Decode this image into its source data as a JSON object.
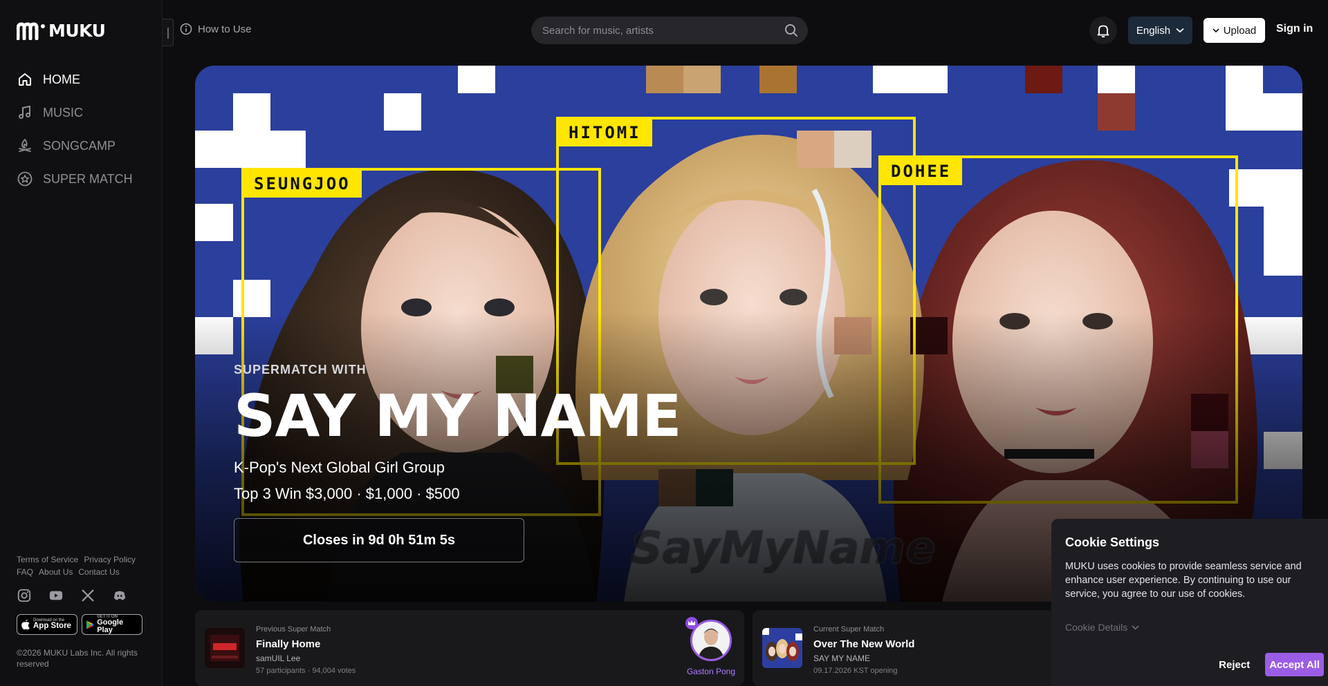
{
  "app": {
    "name": "MUKU"
  },
  "sidebar": {
    "items": [
      {
        "label": "HOME",
        "icon": "home-icon",
        "active": true
      },
      {
        "label": "MUSIC",
        "icon": "music-note-icon",
        "active": false
      },
      {
        "label": "SONGCAMP",
        "icon": "campfire-icon",
        "active": false
      },
      {
        "label": "SUPER MATCH",
        "icon": "star-badge-icon",
        "active": false
      }
    ],
    "footer_links": [
      "Terms of Service",
      "Privacy Policy",
      "FAQ",
      "About Us",
      "Contact Us"
    ],
    "socials": [
      "instagram-icon",
      "youtube-icon",
      "x-icon",
      "discord-icon"
    ],
    "stores": {
      "app_store": {
        "small": "Download on the",
        "big": "App Store"
      },
      "google_play": {
        "small": "GET IT ON",
        "big": "Google Play"
      }
    },
    "copyright": "©2026 MUKU Labs Inc. All rights reserved"
  },
  "header": {
    "how_to": "How to Use",
    "search_placeholder": "Search for music, artists",
    "language": "English",
    "upload": "Upload",
    "sign_in": "Sign in"
  },
  "hero": {
    "name_tags": [
      "SEUNGJOO",
      "HITOMI",
      "DOHEE"
    ],
    "eyebrow": "SUPERMATCH WITH",
    "title": "SAY MY NAME",
    "subtitle": "K-Pop's Next Global Girl Group",
    "prizes": "Top 3 Win $3,000 · $1,000 · $500",
    "cta": "Closes in 9d 0h 51m 5s",
    "accent_color": "#ffe600",
    "background_color": "#2b3f9c"
  },
  "cards": {
    "previous": {
      "eyebrow": "Previous Super Match",
      "title": "Finally Home",
      "artist": "samUIL Lee",
      "meta": "57 participants · 94,004 votes",
      "winner": "Gaston Pong"
    },
    "current": {
      "eyebrow": "Current Super Match",
      "title": "Over The New World",
      "artist": "SAY MY NAME",
      "meta": "09.17.2026 KST opening"
    }
  },
  "cookie": {
    "title": "Cookie Settings",
    "body": "MUKU uses cookies to provide seamless service and enhance user experience. By continuing to use our service, you agree to our use of cookies.",
    "details": "Cookie Details",
    "reject": "Reject",
    "accept": "Accept All",
    "accent_color": "#9b5de5"
  }
}
